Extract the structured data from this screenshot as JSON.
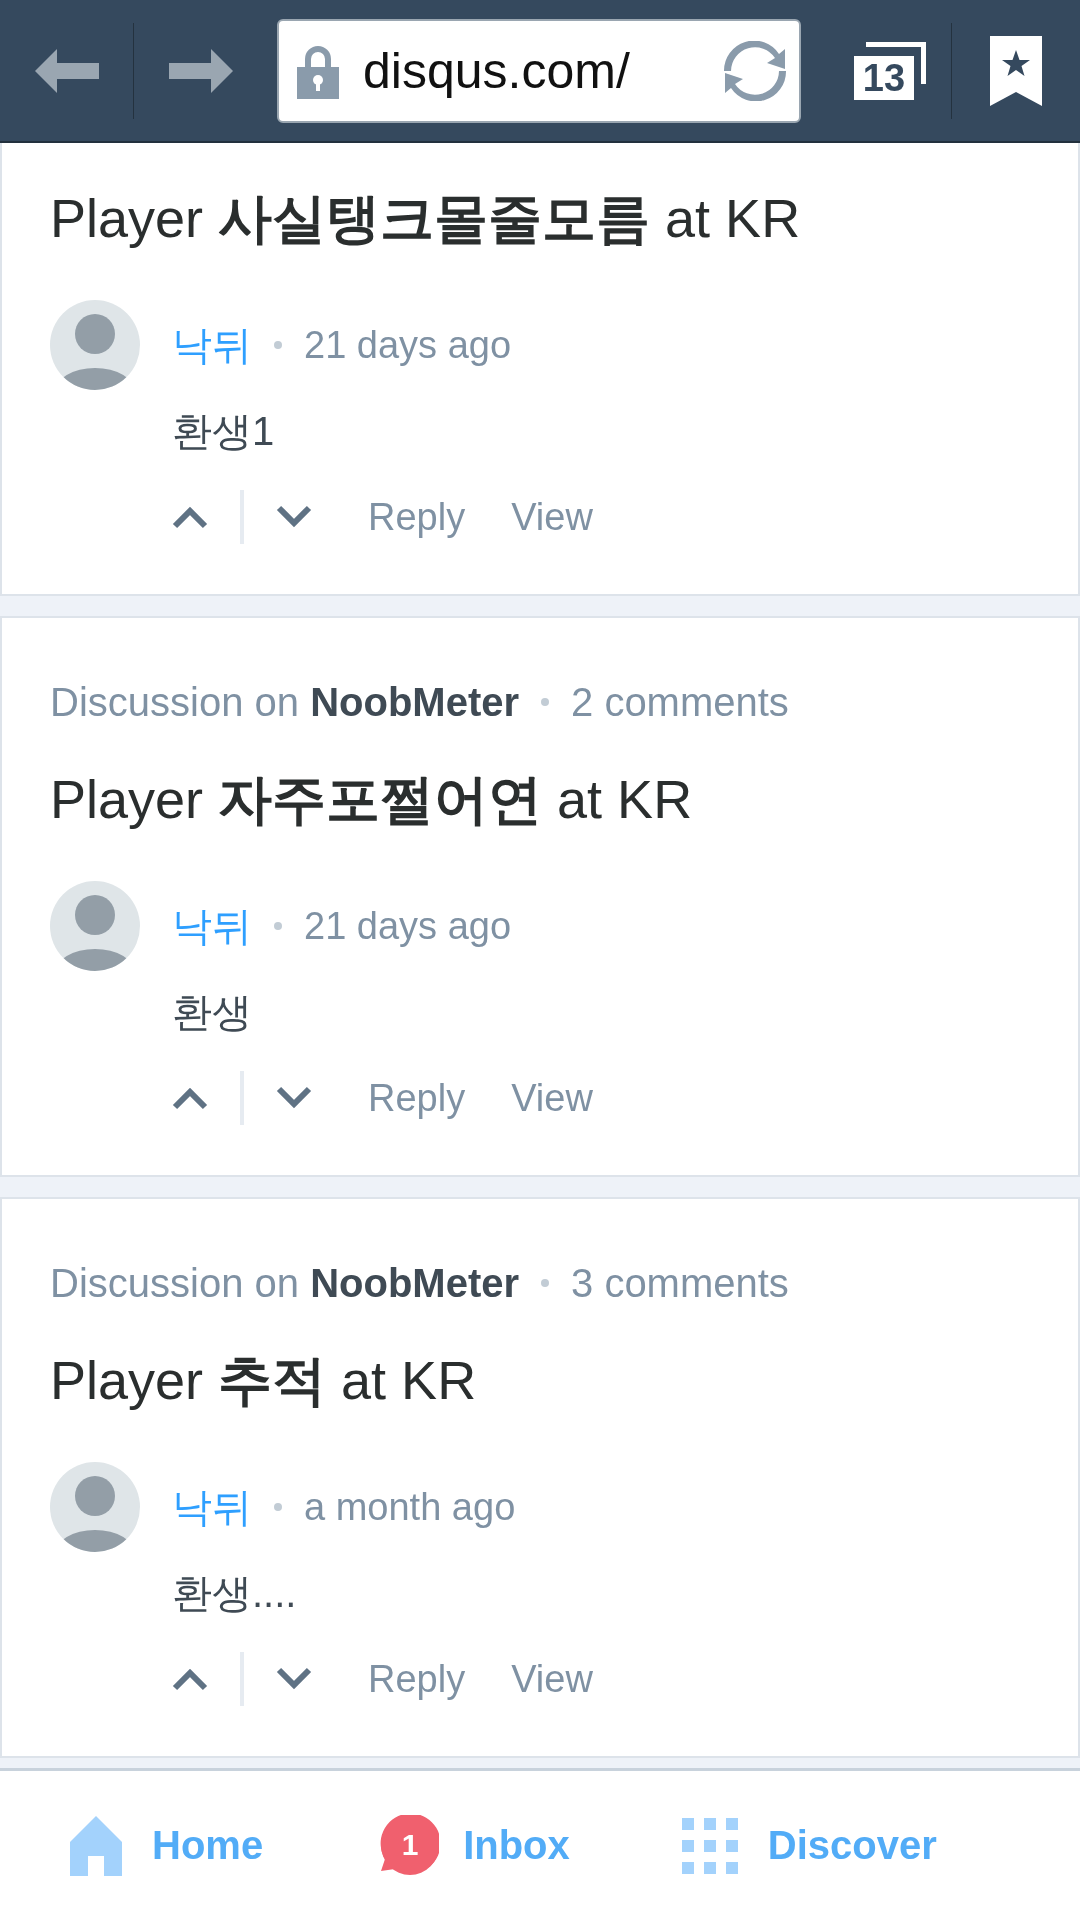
{
  "browser": {
    "url": "disqus.com/",
    "tab_count": "13"
  },
  "cards": [
    {
      "title": "Player **사실탱크몰줄모름** at KR",
      "comment": {
        "author": "낙뒤",
        "time": "21 days ago",
        "body": "환생1",
        "actions": [
          "Reply",
          "View"
        ]
      }
    },
    {
      "discussion": "Discussion on **NoobMeter**",
      "comments_count": "2 comments",
      "title": "Player **자주포쩔어연** at KR",
      "comment": {
        "author": "낙뒤",
        "time": "21 days ago",
        "body": "환생",
        "actions": [
          "Reply",
          "View"
        ]
      }
    },
    {
      "discussion": "Discussion on **NoobMeter**",
      "comments_count": "3 comments",
      "title": "Player **추적** at KR",
      "comment": {
        "author": "낙뒤",
        "time": "a month ago",
        "body": "환생....",
        "actions": [
          "Reply",
          "View"
        ]
      }
    }
  ],
  "bottom_nav": [
    {
      "kind": "home",
      "label": "Home"
    },
    {
      "kind": "inbox",
      "label": "Inbox",
      "badge": "1"
    },
    {
      "kind": "discover",
      "label": "Discover"
    }
  ]
}
